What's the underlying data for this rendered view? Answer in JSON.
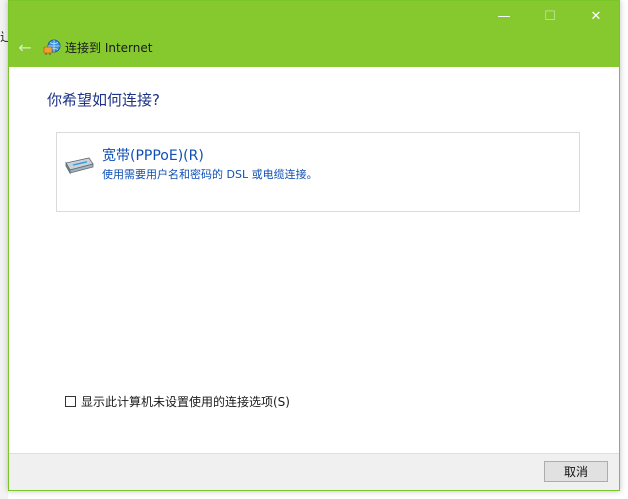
{
  "background": {
    "text_fragment": "辶"
  },
  "window": {
    "controls": {
      "minimize": "—",
      "maximize": "☐",
      "close": "✕"
    },
    "back_arrow": "←",
    "title": "连接到 Internet"
  },
  "content": {
    "heading": "你希望如何连接?",
    "option": {
      "title": "宽带(PPPoE)(R)",
      "description": "使用需要用户名和密码的 DSL 或电缆连接。"
    },
    "checkbox_label": "显示此计算机未设置使用的连接选项(S)"
  },
  "footer": {
    "cancel_label": "取消"
  },
  "colors": {
    "titlebar": "#85c92e",
    "heading": "#1e3287",
    "link": "#0f4fb5"
  }
}
